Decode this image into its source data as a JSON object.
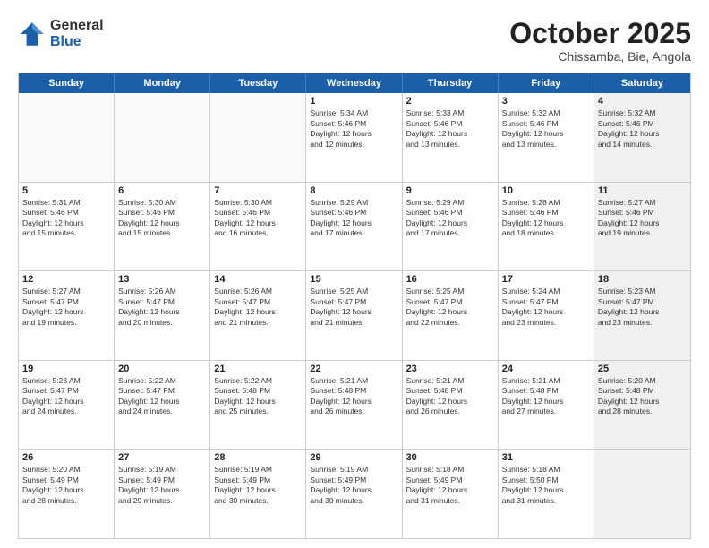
{
  "header": {
    "logo_general": "General",
    "logo_blue": "Blue",
    "month_title": "October 2025",
    "subtitle": "Chissamba, Bie, Angola"
  },
  "weekdays": [
    "Sunday",
    "Monday",
    "Tuesday",
    "Wednesday",
    "Thursday",
    "Friday",
    "Saturday"
  ],
  "rows": [
    [
      {
        "day": "",
        "text": "",
        "empty": true
      },
      {
        "day": "",
        "text": "",
        "empty": true
      },
      {
        "day": "",
        "text": "",
        "empty": true
      },
      {
        "day": "1",
        "text": "Sunrise: 5:34 AM\nSunset: 5:46 PM\nDaylight: 12 hours\nand 12 minutes."
      },
      {
        "day": "2",
        "text": "Sunrise: 5:33 AM\nSunset: 5:46 PM\nDaylight: 12 hours\nand 13 minutes."
      },
      {
        "day": "3",
        "text": "Sunrise: 5:32 AM\nSunset: 5:46 PM\nDaylight: 12 hours\nand 13 minutes."
      },
      {
        "day": "4",
        "text": "Sunrise: 5:32 AM\nSunset: 5:46 PM\nDaylight: 12 hours\nand 14 minutes.",
        "shaded": true
      }
    ],
    [
      {
        "day": "5",
        "text": "Sunrise: 5:31 AM\nSunset: 5:46 PM\nDaylight: 12 hours\nand 15 minutes."
      },
      {
        "day": "6",
        "text": "Sunrise: 5:30 AM\nSunset: 5:46 PM\nDaylight: 12 hours\nand 15 minutes."
      },
      {
        "day": "7",
        "text": "Sunrise: 5:30 AM\nSunset: 5:46 PM\nDaylight: 12 hours\nand 16 minutes."
      },
      {
        "day": "8",
        "text": "Sunrise: 5:29 AM\nSunset: 5:46 PM\nDaylight: 12 hours\nand 17 minutes."
      },
      {
        "day": "9",
        "text": "Sunrise: 5:29 AM\nSunset: 5:46 PM\nDaylight: 12 hours\nand 17 minutes."
      },
      {
        "day": "10",
        "text": "Sunrise: 5:28 AM\nSunset: 5:46 PM\nDaylight: 12 hours\nand 18 minutes."
      },
      {
        "day": "11",
        "text": "Sunrise: 5:27 AM\nSunset: 5:46 PM\nDaylight: 12 hours\nand 19 minutes.",
        "shaded": true
      }
    ],
    [
      {
        "day": "12",
        "text": "Sunrise: 5:27 AM\nSunset: 5:47 PM\nDaylight: 12 hours\nand 19 minutes."
      },
      {
        "day": "13",
        "text": "Sunrise: 5:26 AM\nSunset: 5:47 PM\nDaylight: 12 hours\nand 20 minutes."
      },
      {
        "day": "14",
        "text": "Sunrise: 5:26 AM\nSunset: 5:47 PM\nDaylight: 12 hours\nand 21 minutes."
      },
      {
        "day": "15",
        "text": "Sunrise: 5:25 AM\nSunset: 5:47 PM\nDaylight: 12 hours\nand 21 minutes."
      },
      {
        "day": "16",
        "text": "Sunrise: 5:25 AM\nSunset: 5:47 PM\nDaylight: 12 hours\nand 22 minutes."
      },
      {
        "day": "17",
        "text": "Sunrise: 5:24 AM\nSunset: 5:47 PM\nDaylight: 12 hours\nand 23 minutes."
      },
      {
        "day": "18",
        "text": "Sunrise: 5:23 AM\nSunset: 5:47 PM\nDaylight: 12 hours\nand 23 minutes.",
        "shaded": true
      }
    ],
    [
      {
        "day": "19",
        "text": "Sunrise: 5:23 AM\nSunset: 5:47 PM\nDaylight: 12 hours\nand 24 minutes."
      },
      {
        "day": "20",
        "text": "Sunrise: 5:22 AM\nSunset: 5:47 PM\nDaylight: 12 hours\nand 24 minutes."
      },
      {
        "day": "21",
        "text": "Sunrise: 5:22 AM\nSunset: 5:48 PM\nDaylight: 12 hours\nand 25 minutes."
      },
      {
        "day": "22",
        "text": "Sunrise: 5:21 AM\nSunset: 5:48 PM\nDaylight: 12 hours\nand 26 minutes."
      },
      {
        "day": "23",
        "text": "Sunrise: 5:21 AM\nSunset: 5:48 PM\nDaylight: 12 hours\nand 26 minutes."
      },
      {
        "day": "24",
        "text": "Sunrise: 5:21 AM\nSunset: 5:48 PM\nDaylight: 12 hours\nand 27 minutes."
      },
      {
        "day": "25",
        "text": "Sunrise: 5:20 AM\nSunset: 5:48 PM\nDaylight: 12 hours\nand 28 minutes.",
        "shaded": true
      }
    ],
    [
      {
        "day": "26",
        "text": "Sunrise: 5:20 AM\nSunset: 5:49 PM\nDaylight: 12 hours\nand 28 minutes."
      },
      {
        "day": "27",
        "text": "Sunrise: 5:19 AM\nSunset: 5:49 PM\nDaylight: 12 hours\nand 29 minutes."
      },
      {
        "day": "28",
        "text": "Sunrise: 5:19 AM\nSunset: 5:49 PM\nDaylight: 12 hours\nand 30 minutes."
      },
      {
        "day": "29",
        "text": "Sunrise: 5:19 AM\nSunset: 5:49 PM\nDaylight: 12 hours\nand 30 minutes."
      },
      {
        "day": "30",
        "text": "Sunrise: 5:18 AM\nSunset: 5:49 PM\nDaylight: 12 hours\nand 31 minutes."
      },
      {
        "day": "31",
        "text": "Sunrise: 5:18 AM\nSunset: 5:50 PM\nDaylight: 12 hours\nand 31 minutes."
      },
      {
        "day": "",
        "text": "",
        "empty": true,
        "shaded": true
      }
    ]
  ]
}
